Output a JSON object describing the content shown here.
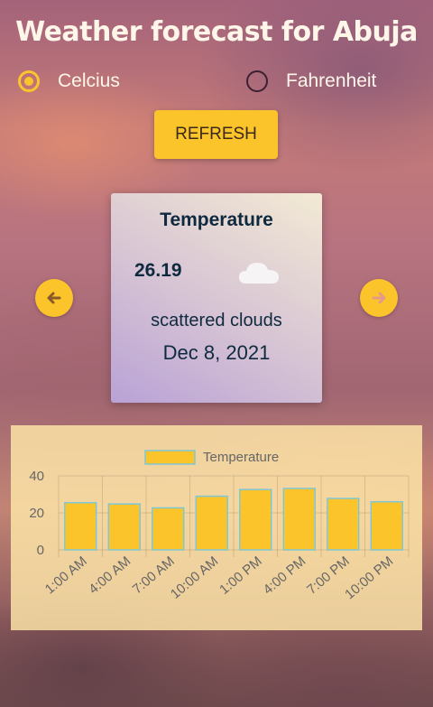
{
  "header": {
    "title": "Weather forecast for Abuja"
  },
  "units": {
    "options": [
      {
        "label": "Celcius",
        "selected": true
      },
      {
        "label": "Fahrenheit",
        "selected": false
      }
    ]
  },
  "toolbar": {
    "refresh_label": "REFRESH"
  },
  "card": {
    "heading": "Temperature",
    "temperature": "26.19",
    "icon": "cloud-icon",
    "description": "scattered clouds",
    "date": "Dec 8, 2021"
  },
  "navigation": {
    "prev_icon": "arrow-left-icon",
    "next_icon": "arrow-right-icon"
  },
  "colors": {
    "accent": "#fcc42b",
    "bar_fill": "#fcc42b",
    "bar_border": "#7fc7d6"
  },
  "chart_data": {
    "type": "bar",
    "categories": [
      "1:00 AM",
      "4:00 AM",
      "7:00 AM",
      "10:00 AM",
      "1:00 PM",
      "4:00 PM",
      "7:00 PM",
      "10:00 PM"
    ],
    "series": [
      {
        "name": "Temperature",
        "values": [
          25.5,
          24.8,
          22.7,
          29.0,
          32.6,
          33.2,
          27.8,
          26.0
        ]
      }
    ],
    "yticks": [
      0,
      20,
      40
    ],
    "ylim": [
      0,
      40
    ],
    "legend": "top",
    "grid": true
  }
}
